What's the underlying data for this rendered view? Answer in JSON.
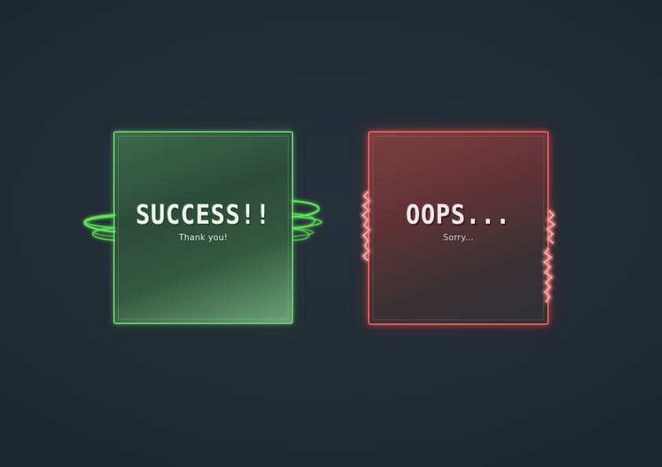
{
  "success": {
    "title": "SUCCESS!!",
    "subtitle": "Thank you!",
    "accent": "#64c468",
    "effect_icon": "swirl-rings-icon"
  },
  "error": {
    "title": "OOPS...",
    "subtitle": "Sorry...",
    "accent": "#e25a58",
    "effect_icon": "electric-spark-icon"
  },
  "background_color": "#232d36"
}
